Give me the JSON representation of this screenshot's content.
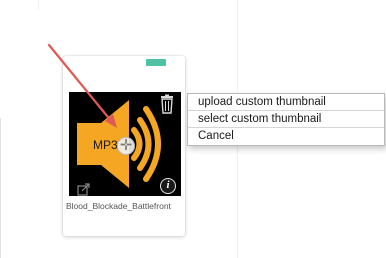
{
  "card": {
    "file_name": "Blood_Blockade_Battlefront",
    "thumbnail_icon": "speaker-audio-icon",
    "thumbnail_label": "MP3",
    "accent_color": "#4fc2a6",
    "speaker_color": "#f5a623"
  },
  "context_menu": {
    "items": [
      {
        "label": "upload custom thumbnail"
      },
      {
        "label": "select custom thumbnail"
      },
      {
        "label": "Cancel"
      }
    ]
  },
  "icons": {
    "delete": "trash-icon",
    "info": "info-icon",
    "open": "external-link-icon",
    "move": "move-handle-icon",
    "annotation": "red-arrow-icon"
  },
  "colors": {
    "annotation_arrow": "#e05a55",
    "info_badge": "#1a1a1a"
  }
}
